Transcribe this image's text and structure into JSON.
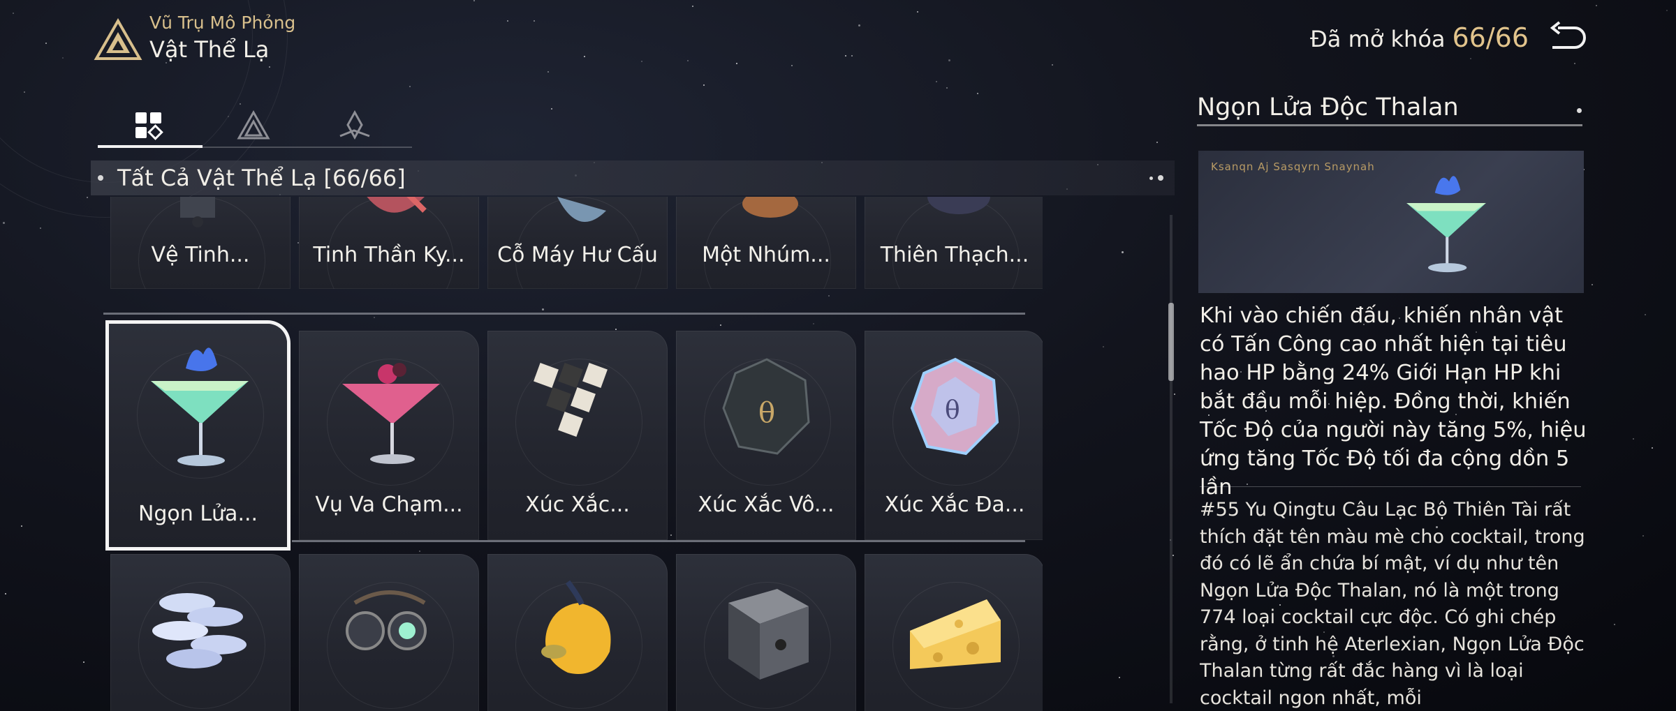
{
  "header": {
    "subtitle": "Vũ Trụ Mô Phỏng",
    "title": "Vật Thể Lạ",
    "unlock_label": "Đã mở khóa",
    "unlock_count": "66/66"
  },
  "tabs": [
    {
      "icon": "grid-all-icon",
      "active": true
    },
    {
      "icon": "triangle-emblem-icon",
      "active": false
    },
    {
      "icon": "trefoil-emblem-icon",
      "active": false
    }
  ],
  "section": {
    "title": "Tất Cả Vật Thể Lạ [66/66]"
  },
  "rows": [
    {
      "items": [
        {
          "label": "Vệ Tinh...",
          "icon": "satellite-icon"
        },
        {
          "label": "Tinh Thần Ky...",
          "icon": "spirit-icon"
        },
        {
          "label": "Cỗ Máy Hư Cấu",
          "icon": "machine-icon"
        },
        {
          "label": "Một Nhúm...",
          "icon": "pinch-icon"
        },
        {
          "label": "Thiên Thạch...",
          "icon": "meteor-icon"
        }
      ]
    },
    {
      "items": [
        {
          "label": "Ngọn Lửa...",
          "icon": "blue-flame-cocktail-icon",
          "selected": true
        },
        {
          "label": "Vụ Va Chạm...",
          "icon": "pink-cocktail-icon"
        },
        {
          "label": "Xúc Xắc...",
          "icon": "dice-pyramid-icon"
        },
        {
          "label": "Xúc Xắc Vô...",
          "icon": "dark-d12-dice-icon"
        },
        {
          "label": "Xúc Xắc Đa...",
          "icon": "crystal-d12-dice-icon"
        }
      ]
    },
    {
      "items": [
        {
          "label": "",
          "icon": "plates-stack-icon"
        },
        {
          "label": "",
          "icon": "goggles-device-icon"
        },
        {
          "label": "",
          "icon": "golden-fruit-icon"
        },
        {
          "label": "",
          "icon": "metal-box-icon"
        },
        {
          "label": "",
          "icon": "cheese-icon"
        }
      ]
    }
  ],
  "detail": {
    "title": "Ngọn Lửa Độc Thalan",
    "preview_caption": "Ksanqn Aj Sasqyrn Snaynah",
    "preview_icon": "blue-flame-cocktail-icon",
    "description": "Khi vào chiến đấu, khiến nhân vật có Tấn Công cao nhất hiện tại tiêu hao HP bằng 24% Giới Hạn HP khi bắt đầu mỗi hiệp. Đồng thời, khiến Tốc Độ của người này tăng 5%, hiệu ứng tăng Tốc Độ tối đa cộng dồn 5 lần",
    "lore": "#55 Yu Qingtu Câu Lạc Bộ Thiên Tài rất thích đặt tên màu mè cho cocktail, trong đó có lẽ ẩn chứa bí mật, ví dụ như tên Ngọn Lửa Độc Thalan, nó là một trong 774 loại cocktail cực độc. Có ghi chép rằng, ở tinh hệ Aterlexian, Ngọn Lửa Độc Thalan từng rất đắc hàng vì là loại cocktail ngon nhất, mỗi"
  },
  "colors": {
    "accent_gold": "#e2c48c",
    "subtitle_gold": "#d8bf8c",
    "selection": "#f4f4f4"
  }
}
